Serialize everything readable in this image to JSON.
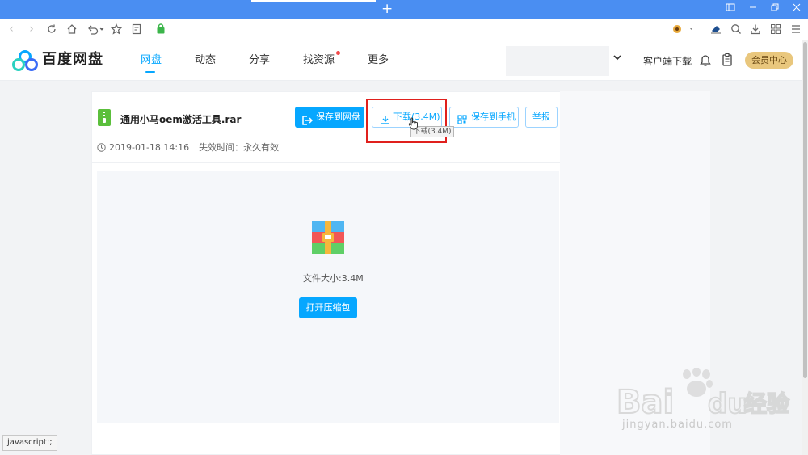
{
  "browser": {
    "new_tab_icon": "plus-icon",
    "window_controls": [
      "sidebar-icon",
      "minimize-icon",
      "restore-icon",
      "close-icon"
    ]
  },
  "site": {
    "logo_text": "百度网盘",
    "nav": [
      "网盘",
      "动态",
      "分享",
      "找资源",
      "更多"
    ],
    "active_nav": "网盘",
    "client_download": "客户端下载",
    "vip_center": "会员中心",
    "colors": {
      "accent": "#06a7ff",
      "vip": "#e9c77d",
      "highlight_red": "#e0201d"
    }
  },
  "file": {
    "name": "通用小马oem激活工具.rar",
    "date": "2019-01-18 14:16",
    "expiry": "失效时间：永久有效",
    "size_label": "文件大小:3.4M",
    "open_label": "打开压缩包"
  },
  "actions": {
    "save_to_disk": "保存到网盘",
    "download": "下载(3.4M)",
    "save_to_phone": "保存到手机",
    "report": "举报",
    "tooltip": "下载(3.4M)"
  },
  "status_bar": "javascript:;",
  "watermark": {
    "brand": "Bai du 经验",
    "url": "jingyan.baidu.com"
  }
}
